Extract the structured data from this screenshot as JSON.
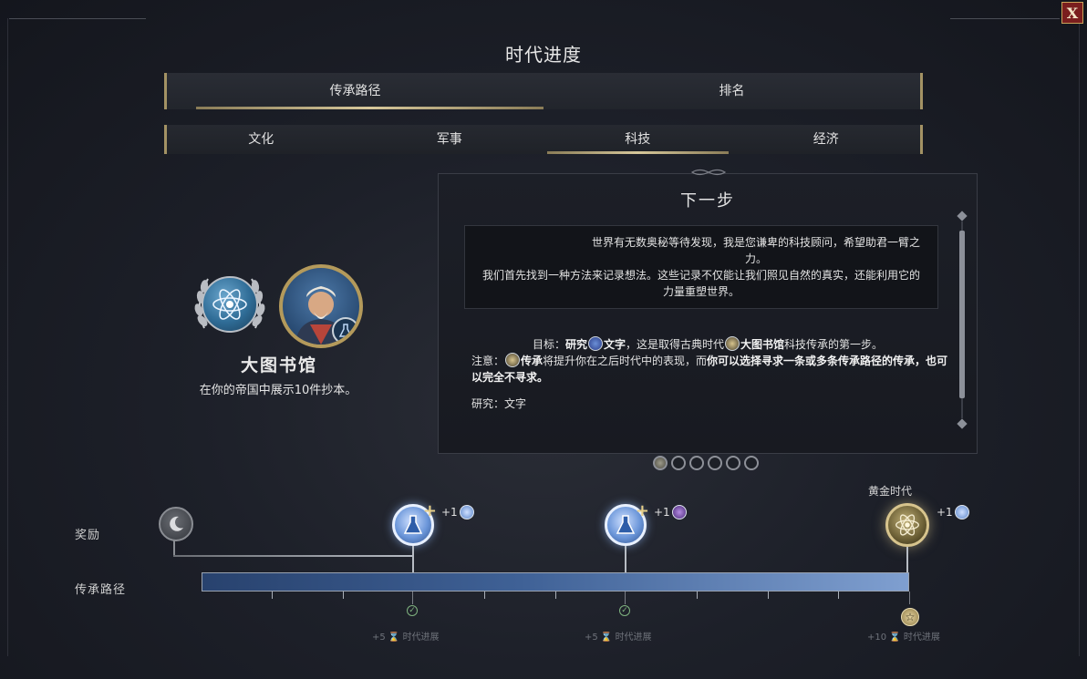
{
  "title": "时代进度",
  "close_label": "X",
  "main_tabs": [
    {
      "label": "传承路径",
      "active": true
    },
    {
      "label": "排名",
      "active": false
    }
  ],
  "sub_tabs": [
    {
      "label": "文化",
      "active": false
    },
    {
      "label": "军事",
      "active": false
    },
    {
      "label": "科技",
      "active": true
    },
    {
      "label": "经济",
      "active": false
    }
  ],
  "legacy": {
    "name": "大图书馆",
    "description": "在你的帝国中展示10件抄本。"
  },
  "next_step": {
    "title": "下一步",
    "quote_line1": "世界有无数奥秘等待发现，我是您谦卑的科技顾问，希望助君一臂之力。",
    "quote_line2": "我们首先找到一种方法来记录想法。这些记录不仅能让我们照见自然的真实，还能利用它的",
    "quote_line3": "力量重塑世界。",
    "goal_prefix": "目标：",
    "goal_research": "研究",
    "goal_tech": "文字",
    "goal_mid": "，这是取得古典时代",
    "goal_wonder": "大图书馆",
    "goal_suffix": "科技传承的第一步。",
    "note_prefix": "注意：",
    "note_legacy": "传承",
    "note_mid": "将提升你在之后时代中的表现，而",
    "note_bold": "你可以选择寻求一条或多条传承路径的传承，也可以完全不寻求。",
    "research_label": "研究：文字"
  },
  "pager": {
    "count": 6,
    "active_index": 0
  },
  "rows": {
    "rewards_label": "奖励",
    "legacy_path_label": "传承路径"
  },
  "rewards": [
    {
      "bonus": "+1",
      "icon": "codex-icon"
    },
    {
      "bonus": "+1",
      "icon": "tech-icon"
    },
    {
      "bonus": "+1",
      "icon": "codex-icon",
      "label": "黄金时代"
    }
  ],
  "milestones": [
    {
      "text": "+5",
      "unit": "时代进展",
      "kind": "check"
    },
    {
      "text": "+5",
      "unit": "时代进展",
      "kind": "check"
    },
    {
      "text": "+10",
      "unit": "时代进展",
      "kind": "star"
    }
  ],
  "progress": {
    "fraction": 1.0
  },
  "colors": {
    "accent_gold": "#a39264",
    "close_red": "#7a1e1e",
    "progress_blue": "#3f6196"
  }
}
